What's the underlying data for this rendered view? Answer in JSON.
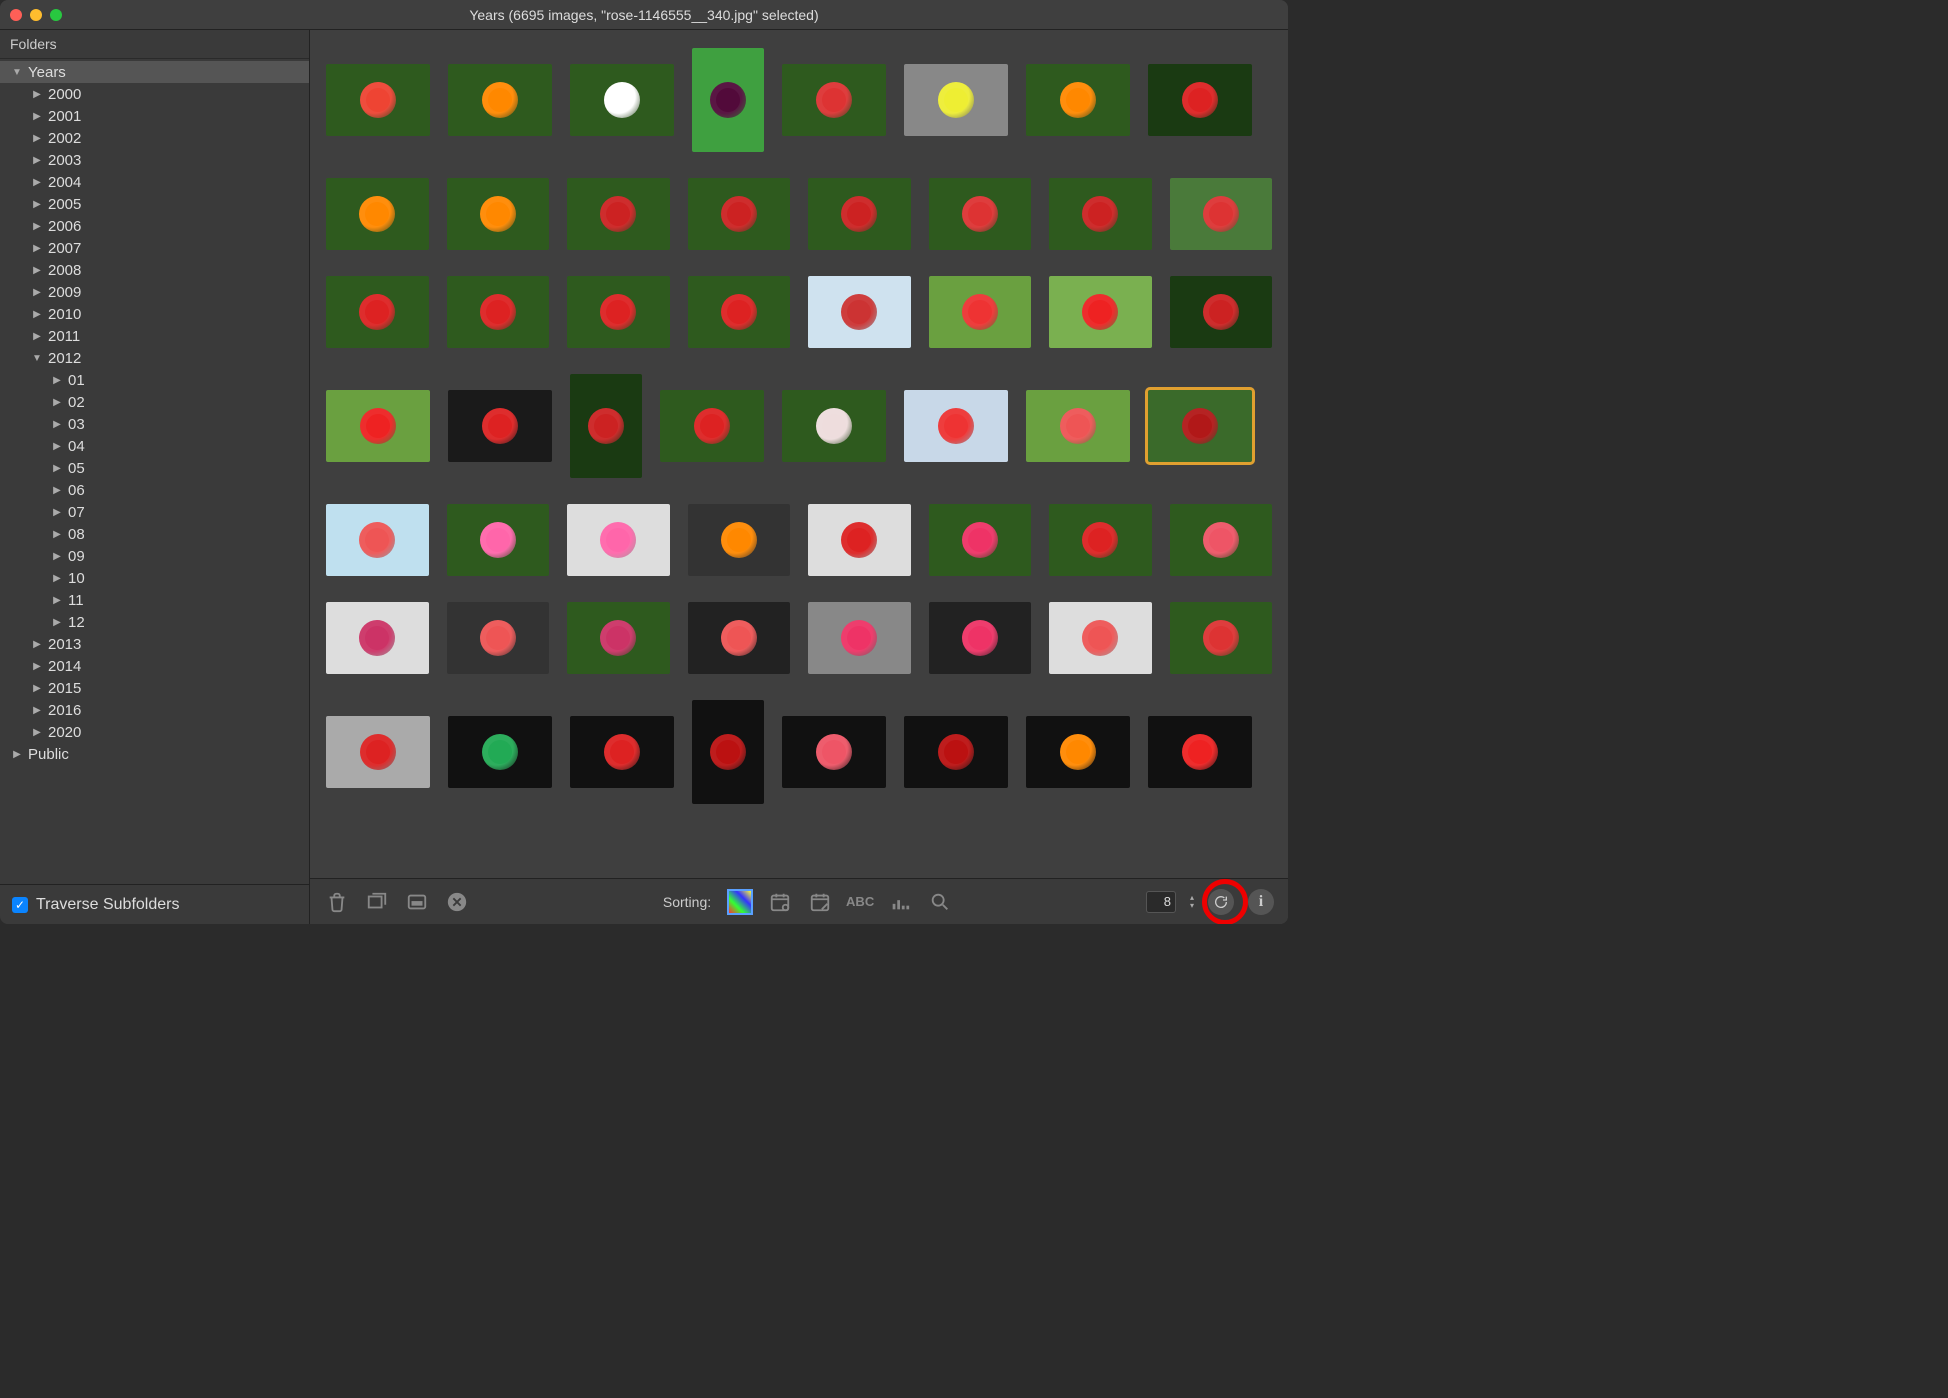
{
  "window": {
    "title": "Years (6695 images, \"rose-1146555__340.jpg\" selected)"
  },
  "sidebar": {
    "header": "Folders",
    "traverse_label": "Traverse Subfolders",
    "traverse_checked": true,
    "tree": [
      {
        "label": "Years",
        "depth": 0,
        "expanded": true,
        "selected": true
      },
      {
        "label": "2000",
        "depth": 1,
        "expanded": false
      },
      {
        "label": "2001",
        "depth": 1,
        "expanded": false
      },
      {
        "label": "2002",
        "depth": 1,
        "expanded": false
      },
      {
        "label": "2003",
        "depth": 1,
        "expanded": false
      },
      {
        "label": "2004",
        "depth": 1,
        "expanded": false
      },
      {
        "label": "2005",
        "depth": 1,
        "expanded": false
      },
      {
        "label": "2006",
        "depth": 1,
        "expanded": false
      },
      {
        "label": "2007",
        "depth": 1,
        "expanded": false
      },
      {
        "label": "2008",
        "depth": 1,
        "expanded": false
      },
      {
        "label": "2009",
        "depth": 1,
        "expanded": false
      },
      {
        "label": "2010",
        "depth": 1,
        "expanded": false
      },
      {
        "label": "2011",
        "depth": 1,
        "expanded": false
      },
      {
        "label": "2012",
        "depth": 1,
        "expanded": true
      },
      {
        "label": "01",
        "depth": 2,
        "expanded": false
      },
      {
        "label": "02",
        "depth": 2,
        "expanded": false
      },
      {
        "label": "03",
        "depth": 2,
        "expanded": false
      },
      {
        "label": "04",
        "depth": 2,
        "expanded": false
      },
      {
        "label": "05",
        "depth": 2,
        "expanded": false
      },
      {
        "label": "06",
        "depth": 2,
        "expanded": false
      },
      {
        "label": "07",
        "depth": 2,
        "expanded": false
      },
      {
        "label": "08",
        "depth": 2,
        "expanded": false
      },
      {
        "label": "09",
        "depth": 2,
        "expanded": false
      },
      {
        "label": "10",
        "depth": 2,
        "expanded": false
      },
      {
        "label": "11",
        "depth": 2,
        "expanded": false
      },
      {
        "label": "12",
        "depth": 2,
        "expanded": false
      },
      {
        "label": "2013",
        "depth": 1,
        "expanded": false
      },
      {
        "label": "2014",
        "depth": 1,
        "expanded": false
      },
      {
        "label": "2015",
        "depth": 1,
        "expanded": false
      },
      {
        "label": "2016",
        "depth": 1,
        "expanded": false
      },
      {
        "label": "2020",
        "depth": 1,
        "expanded": false
      },
      {
        "label": "Public",
        "depth": 0,
        "expanded": false
      }
    ]
  },
  "toolbar": {
    "sorting_label": "Sorting:",
    "columns_value": "8"
  },
  "grid": {
    "rows": [
      [
        {
          "bg": "#2e5a1e",
          "fg": "#e43",
          "tall": false
        },
        {
          "bg": "#2e5a1e",
          "fg": "#f80",
          "tall": false
        },
        {
          "bg": "#2e5a1e",
          "fg": "#fff",
          "tall": false
        },
        {
          "bg": "#3fa040",
          "fg": "#520a3a",
          "tall": true
        },
        {
          "bg": "#2e5a1e",
          "fg": "#d33",
          "tall": false
        },
        {
          "bg": "#888",
          "fg": "#ee3",
          "tall": false
        },
        {
          "bg": "#2e5a1e",
          "fg": "#f80",
          "tall": false
        },
        {
          "bg": "#1a3a12",
          "fg": "#d22",
          "tall": false
        }
      ],
      [
        {
          "bg": "#2e5a1e",
          "fg": "#f80",
          "tall": false
        },
        {
          "bg": "#2e5a1e",
          "fg": "#f80",
          "tall": false
        },
        {
          "bg": "#2e5a1e",
          "fg": "#c22",
          "tall": false
        },
        {
          "bg": "#2e5a1e",
          "fg": "#c22",
          "tall": false
        },
        {
          "bg": "#2e5a1e",
          "fg": "#c22",
          "tall": false
        },
        {
          "bg": "#2e5a1e",
          "fg": "#d33",
          "tall": false
        },
        {
          "bg": "#2e5a1e",
          "fg": "#c22",
          "tall": false
        },
        {
          "bg": "#4a7a3a",
          "fg": "#d33",
          "tall": false
        }
      ],
      [
        {
          "bg": "#2e5a1e",
          "fg": "#d22",
          "tall": false
        },
        {
          "bg": "#2e5a1e",
          "fg": "#d22",
          "tall": false
        },
        {
          "bg": "#2e5a1e",
          "fg": "#d22",
          "tall": false
        },
        {
          "bg": "#2e5a1e",
          "fg": "#d22",
          "tall": false
        },
        {
          "bg": "#cfe2ef",
          "fg": "#c33",
          "tall": false
        },
        {
          "bg": "#6aa040",
          "fg": "#e33",
          "tall": false
        },
        {
          "bg": "#7ab050",
          "fg": "#e22",
          "tall": false
        },
        {
          "bg": "#1a3a12",
          "fg": "#c22",
          "tall": false
        }
      ],
      [
        {
          "bg": "#6aa040",
          "fg": "#e22",
          "tall": false
        },
        {
          "bg": "#1a1a1a",
          "fg": "#d22",
          "tall": false
        },
        {
          "bg": "#1a3a12",
          "fg": "#c22",
          "tall": true
        },
        {
          "bg": "#2e5a1e",
          "fg": "#d22",
          "tall": false
        },
        {
          "bg": "#2e5a1e",
          "fg": "#edd",
          "tall": false
        },
        {
          "bg": "#c8d8e8",
          "fg": "#e33",
          "tall": false
        },
        {
          "bg": "#6aa040",
          "fg": "#e55",
          "tall": false
        },
        {
          "bg": "#3a6a2a",
          "fg": "#b11818",
          "tall": false,
          "selected": true
        }
      ],
      [
        {
          "bg": "#bfe0ef",
          "fg": "#e55",
          "tall": false
        },
        {
          "bg": "#2e5a1e",
          "fg": "#f6a",
          "tall": false
        },
        {
          "bg": "#ddd",
          "fg": "#f6a",
          "tall": false
        },
        {
          "bg": "#333",
          "fg": "#f80",
          "tall": false
        },
        {
          "bg": "#ddd",
          "fg": "#d22",
          "tall": false
        },
        {
          "bg": "#2e5a1e",
          "fg": "#e36",
          "tall": false
        },
        {
          "bg": "#2e5a1e",
          "fg": "#d22",
          "tall": false
        },
        {
          "bg": "#2e5a1e",
          "fg": "#e56",
          "tall": false
        }
      ],
      [
        {
          "bg": "#ddd",
          "fg": "#c36",
          "tall": false
        },
        {
          "bg": "#333",
          "fg": "#e55",
          "tall": false
        },
        {
          "bg": "#2e5a1e",
          "fg": "#c36",
          "tall": false
        },
        {
          "bg": "#222",
          "fg": "#e55",
          "tall": false
        },
        {
          "bg": "#888",
          "fg": "#e36",
          "tall": false
        },
        {
          "bg": "#222",
          "fg": "#e36",
          "tall": false
        },
        {
          "bg": "#ddd",
          "fg": "#e55",
          "tall": false
        },
        {
          "bg": "#2e5a1e",
          "fg": "#d33",
          "tall": false
        }
      ],
      [
        {
          "bg": "#aaa",
          "fg": "#d22",
          "tall": false
        },
        {
          "bg": "#111",
          "fg": "#2a5",
          "tall": false
        },
        {
          "bg": "#111",
          "fg": "#d22",
          "tall": false
        },
        {
          "bg": "#111",
          "fg": "#b11",
          "tall": true
        },
        {
          "bg": "#111",
          "fg": "#e56",
          "tall": false
        },
        {
          "bg": "#111",
          "fg": "#b11",
          "tall": false
        },
        {
          "bg": "#111",
          "fg": "#f80",
          "tall": false
        },
        {
          "bg": "#111",
          "fg": "#e22",
          "tall": false
        }
      ]
    ]
  }
}
